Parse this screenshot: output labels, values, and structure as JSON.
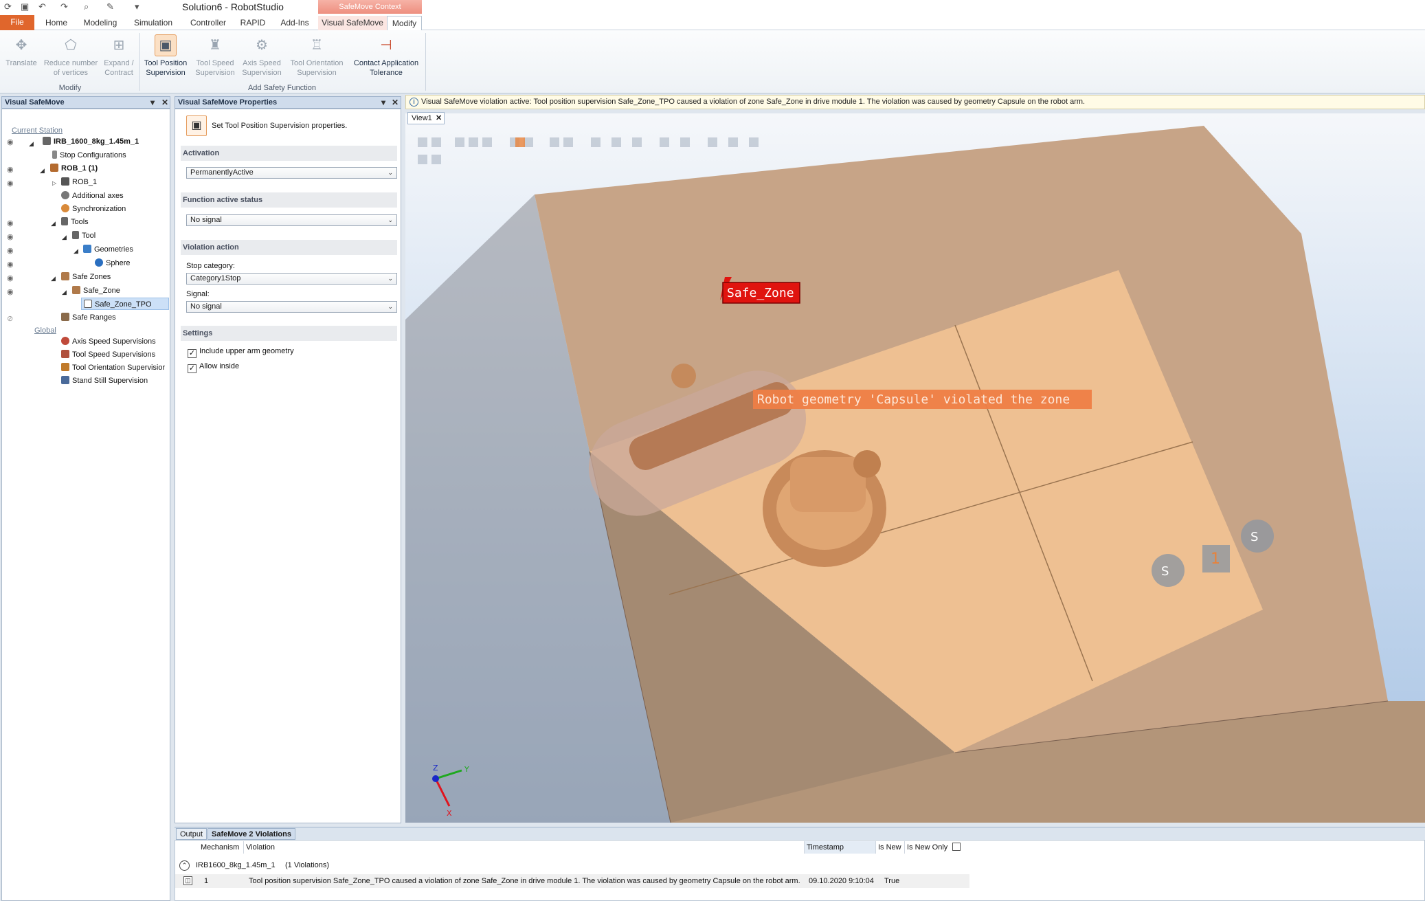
{
  "window": {
    "title": "Solution6 - RobotStudio",
    "context_tab": "SafeMove Context"
  },
  "ribbon_tabs": [
    "File",
    "Home",
    "Modeling",
    "Simulation",
    "Controller",
    "RAPID",
    "Add-Ins",
    "Visual SafeMove",
    "Modify"
  ],
  "ribbon": {
    "modify_group": {
      "label": "Modify",
      "buttons": [
        {
          "label1": "Translate",
          "label2": "",
          "icon": "move-icon"
        },
        {
          "label1": "Reduce number",
          "label2": "of vertices",
          "icon": "vertex-icon"
        },
        {
          "label1": "Expand /",
          "label2": "Contract",
          "icon": "expand-icon"
        }
      ]
    },
    "safety_group": {
      "label": "Add Safety Function",
      "buttons": [
        {
          "label1": "Tool Position",
          "label2": "Supervision",
          "icon": "tool-position-icon"
        },
        {
          "label1": "Tool Speed",
          "label2": "Supervision",
          "icon": "tool-speed-icon"
        },
        {
          "label1": "Axis Speed",
          "label2": "Supervision",
          "icon": "axis-speed-icon"
        },
        {
          "label1": "Tool Orientation",
          "label2": "Supervision",
          "icon": "tool-orientation-icon"
        },
        {
          "label1": "Contact Application",
          "label2": "Tolerance",
          "icon": "contact-icon"
        }
      ]
    }
  },
  "left_panel": {
    "title": "Visual SafeMove",
    "tree": {
      "current_station": "Current Station",
      "irb": "IRB_1600_8kg_1.45m_1",
      "stop_configs": "Stop Configurations",
      "rob1_parent": "ROB_1 (1)",
      "rob1": "ROB_1",
      "additional_axes": "Additional axes",
      "synchronization": "Synchronization",
      "tools": "Tools",
      "tool": "Tool",
      "geometries": "Geometries",
      "sphere": "Sphere",
      "safe_zones": "Safe Zones",
      "safe_zone": "Safe_Zone",
      "safe_zone_tpo": "Safe_Zone_TPO",
      "safe_ranges": "Safe Ranges",
      "global": "Global",
      "axis_speed": "Axis Speed Supervisions",
      "tool_speed": "Tool Speed Supervisions",
      "tool_orientation": "Tool Orientation Supervisior",
      "stand_still": "Stand Still Supervision"
    }
  },
  "properties_panel": {
    "title": "Visual SafeMove Properties",
    "header_text": "Set Tool Position Supervision properties.",
    "activation": {
      "label": "Activation",
      "value": "PermanentlyActive"
    },
    "function_status": {
      "label": "Function active status",
      "value": "No signal"
    },
    "violation_action": {
      "label": "Violation action",
      "stop_label": "Stop category:",
      "stop_value": "Category1Stop",
      "signal_label": "Signal:",
      "signal_value": "No signal"
    },
    "settings": {
      "label": "Settings",
      "check1": "Include upper arm geometry",
      "check2": "Allow inside"
    }
  },
  "infobar": "Visual SafeMove violation active:  Tool position supervision Safe_Zone_TPO caused a violation of zone Safe_Zone in drive module 1. The violation was caused by geometry Capsule on the robot arm.",
  "viewport": {
    "tab": "View1",
    "zone_label": "Safe_Zone",
    "violation_label": "Robot geometry 'Capsule' violated the zone",
    "axes": {
      "x": "X",
      "y": "Y",
      "z": "Z"
    },
    "colors": {
      "zone": "#e8b184",
      "label_red": "#e0140f",
      "violation_bg": "#ee7e46"
    }
  },
  "output": {
    "tabs": [
      "Output",
      "SafeMove 2 Violations"
    ],
    "columns": [
      "Mechanism",
      "Violation",
      "Timestamp",
      "Is New",
      "Is New Only"
    ],
    "group": "IRB1600_8kg_1.45m_1",
    "group_count": "(1 Violations)",
    "row": {
      "index": "1",
      "violation": "Tool position supervision Safe_Zone_TPO caused a violation of zone Safe_Zone in drive module 1. The violation was caused by geometry Capsule on the robot arm.",
      "timestamp": "09.10.2020 9:10:04",
      "is_new": "True"
    }
  }
}
